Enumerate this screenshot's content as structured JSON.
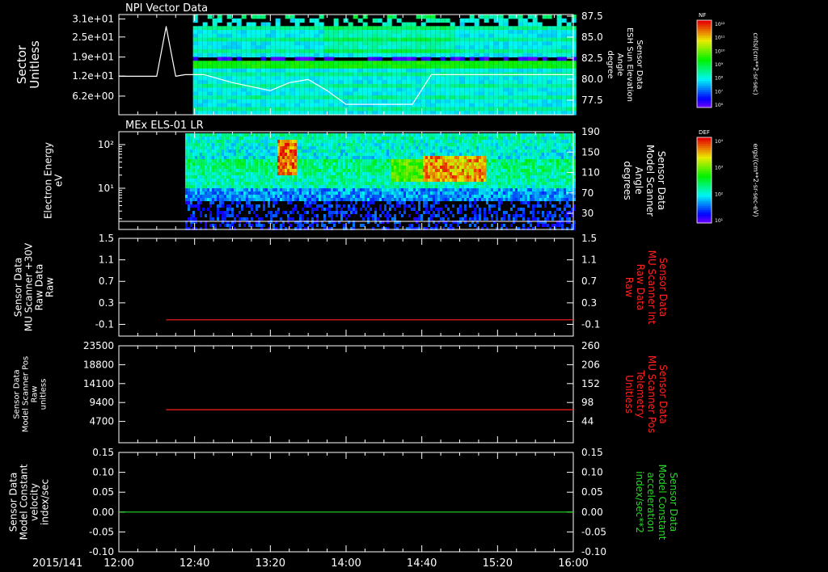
{
  "date_label": "2015/141",
  "time_ticks": [
    "12:00",
    "12:40",
    "13:20",
    "14:00",
    "14:40",
    "15:20",
    "16:00"
  ],
  "chart_data": [
    {
      "type": "heatmap",
      "title": "NPI Vector Data",
      "ylabel_left": [
        "Sector",
        "Unitless"
      ],
      "yticks_left": [
        "3.1e+01",
        "2.5e+01",
        "1.9e+01",
        "1.2e+01",
        "6.2e+00"
      ],
      "ylabel_right": [
        "Sensor Data",
        "ESH Sun Elevation",
        "Angle",
        "degree"
      ],
      "yticks_right": [
        "87.5",
        "85.0",
        "82.5",
        "80.0",
        "77.5"
      ],
      "colorbar": {
        "label": "NF",
        "unit": "cnts/(cm**2-sr-sec)",
        "ticks": [
          "10¹²",
          "10¹¹",
          "10¹⁰",
          "10⁹",
          "10⁸",
          "10⁷",
          "10⁶"
        ]
      },
      "overlay_line": {
        "color": "#ffffff",
        "x": [
          "12:00",
          "12:20",
          "12:25",
          "12:30",
          "12:35",
          "12:45",
          "13:00",
          "13:20",
          "13:30",
          "13:40",
          "13:50",
          "14:00",
          "14:15",
          "14:35",
          "14:45",
          "16:00"
        ],
        "y": [
          80.3,
          80.3,
          86.5,
          80.3,
          80.5,
          80.5,
          79.5,
          78.5,
          79.5,
          79.9,
          78.5,
          76.8,
          76.8,
          76.8,
          80.5,
          80.5
        ]
      }
    },
    {
      "type": "heatmap",
      "title": "MEx ELS-01 LR",
      "ylabel_left": [
        "Electron Energy",
        "eV"
      ],
      "yticks_left": [
        "10²",
        "10¹"
      ],
      "ylabel_right": [
        "Sensor Data",
        "Model Scanner",
        "Angle",
        "degrees"
      ],
      "yticks_right": [
        "190",
        "150",
        "110",
        "70",
        "30"
      ],
      "colorbar": {
        "label": "DEF",
        "unit": "ergs/(cm**2-sr-sec-eV)",
        "ticks": [
          "10⁴",
          "10³",
          "10²",
          "10¹"
        ]
      },
      "overlay_line": {
        "color": "#ffffff",
        "x": [
          "12:00",
          "16:00"
        ],
        "y": [
          10,
          10
        ]
      }
    },
    {
      "type": "line",
      "ylabel_left": [
        "Sensor Data",
        "MU Scanner +30V",
        "Raw Data",
        "Raw"
      ],
      "yticks_left": [
        "1.5",
        "1.1",
        "0.7",
        "0.3",
        "-0.1"
      ],
      "ylim_left": [
        -0.3,
        1.5
      ],
      "ylabel_right": [
        "Sensor Data",
        "MU Scanner Int",
        "Raw Data",
        "Raw"
      ],
      "yticks_right": [
        "1.5",
        "1.1",
        "0.7",
        "0.3",
        "-0.1"
      ],
      "series": [
        {
          "color": "#ff2020",
          "x": [
            "12:25",
            "16:00"
          ],
          "y": [
            0.0,
            0.0
          ]
        }
      ]
    },
    {
      "type": "line",
      "ylabel_left": [
        "Sensor Data",
        "Model Scanner Pos",
        "Raw",
        "unitless"
      ],
      "yticks_left": [
        "23500",
        "18800",
        "14100",
        "9400",
        "4700"
      ],
      "ylim_left": [
        0,
        23500
      ],
      "ylabel_right": [
        "Sensor Data",
        "MU Scanner Pos",
        "Telemetry",
        "Unitless"
      ],
      "yticks_right": [
        "260",
        "206",
        "152",
        "98",
        "44"
      ],
      "series": [
        {
          "color": "#ff2020",
          "x": [
            "12:25",
            "16:00"
          ],
          "y": [
            8000,
            8000
          ]
        }
      ]
    },
    {
      "type": "line",
      "ylabel_left": [
        "Sensor Data",
        "Model Constant",
        "velocity",
        "index/sec"
      ],
      "yticks_left": [
        "0.15",
        "0.10",
        "0.05",
        "0.00",
        "-0.05",
        "-0.10"
      ],
      "ylim_left": [
        -0.1,
        0.15
      ],
      "ylabel_right": [
        "Sensor Data",
        "Model Constant",
        "acceleration",
        "index/sec**2"
      ],
      "yticks_right": [
        "0.15",
        "0.10",
        "0.05",
        "0.00",
        "-0.05",
        "-0.10"
      ],
      "series": [
        {
          "color": "#22dd22",
          "x": [
            "12:00",
            "16:00"
          ],
          "y": [
            0.0,
            0.0
          ]
        }
      ]
    }
  ],
  "colors": {
    "right_label_panel3": "#ff2020",
    "right_label_panel4": "#ff2020",
    "right_label_panel5": "#22dd22"
  }
}
